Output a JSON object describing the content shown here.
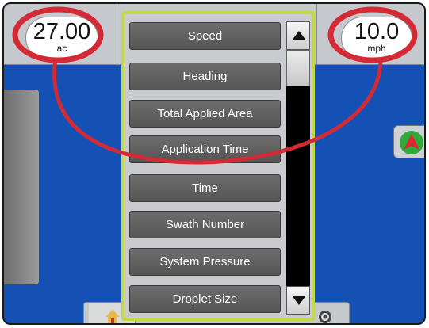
{
  "gauges": {
    "area": {
      "value": "27.00",
      "unit": "ac"
    },
    "speed": {
      "value": "10.0",
      "unit": "mph"
    }
  },
  "selection_list": {
    "items": [
      "Speed",
      "Heading",
      "Total Applied Area",
      "Application Time",
      "Time",
      "Swath Number",
      "System Pressure",
      "Droplet Size"
    ]
  },
  "icons": {
    "home": "home-icon",
    "scroll_up": "triangle-up-icon",
    "scroll_down": "triangle-down-icon",
    "nav": "guidance-arrow-icon",
    "settings": "target-icon"
  },
  "colors": {
    "map_background": "#1550b4",
    "panel_highlight": "#c3d848",
    "callout": "#d42a35"
  }
}
